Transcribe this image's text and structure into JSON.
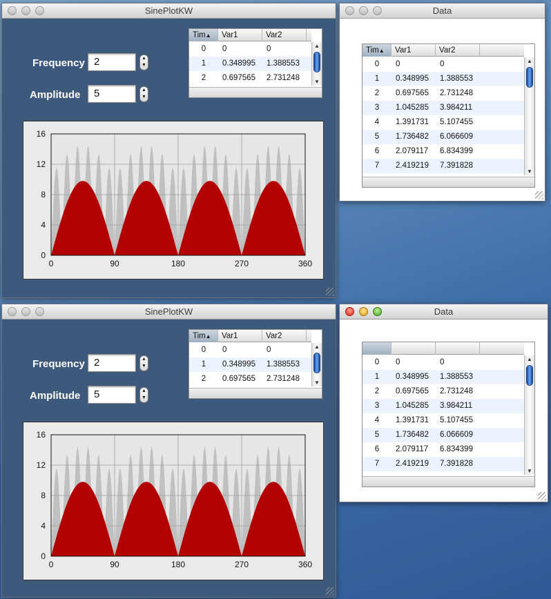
{
  "plot_window_title": "SinePlotKW",
  "data_window_title": "Data",
  "controls": {
    "frequency_label": "Frequency",
    "frequency_value": "2",
    "amplitude_label": "Amplitude",
    "amplitude_value": "5"
  },
  "table": {
    "headers": [
      "Tim",
      "Var1",
      "Var2"
    ],
    "sort_indicator": "▲",
    "rows": [
      [
        "0",
        "0",
        "0"
      ],
      [
        "1",
        "0.348995",
        "1.388553"
      ],
      [
        "2",
        "0.697565",
        "2.731248"
      ],
      [
        "3",
        "1.045285",
        "3.984211"
      ],
      [
        "4",
        "1.391731",
        "5.107455"
      ],
      [
        "5",
        "1.736482",
        "6.066609"
      ],
      [
        "6",
        "2.079117",
        "6.834399"
      ],
      [
        "7",
        "2.419219",
        "7.391828"
      ]
    ]
  },
  "colors": {
    "window_bg": "#3d5a7c",
    "series_fill": "#b30000",
    "background_curve": "#c0c0c0",
    "plot_bg": "#eaeaea"
  },
  "chart_data": {
    "type": "area",
    "x_ticks": [
      "0",
      "90",
      "180",
      "270",
      "360"
    ],
    "y_ticks": [
      "0",
      "4",
      "8",
      "12",
      "16"
    ],
    "xlim": [
      0,
      360
    ],
    "ylim": [
      0,
      16
    ],
    "grid": true,
    "series": [
      {
        "role": "foreground",
        "color": "#b30000",
        "peak": 9.8,
        "humps": 4
      },
      {
        "role": "background",
        "color": "#c0c0c0",
        "peak": 14.5,
        "humps": 24
      }
    ]
  }
}
